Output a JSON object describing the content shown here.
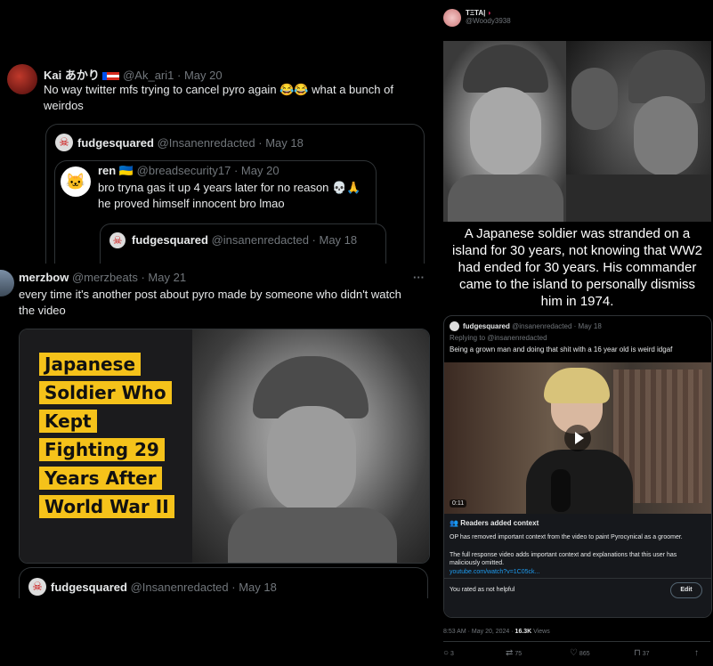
{
  "tweet_kai": {
    "name": "Kai あかり",
    "handle": "@Ak_ari1",
    "date": "· May 20",
    "text_line1": "No way twitter mfs trying to cancel pyro again 😂😂 what a bunch of",
    "text_line2": "weirdos"
  },
  "quote_fudge1": {
    "name": "fudgesquared",
    "handle": "@Insanenredacted",
    "date": "· May 18"
  },
  "quote_ren": {
    "name": "ren 🇺🇦",
    "handle": "@breadsecurity17",
    "date": "· May 20",
    "text_line1": "bro tryna gas it up 4 years later for no reason 💀🙏",
    "text_line2": "he proved himself innocent bro lmao"
  },
  "quote_fudge2": {
    "name": "fudgesquared",
    "handle": "@insanenredacted",
    "date": "· May 18"
  },
  "tweet_merzbow": {
    "name": "merzbow",
    "handle": "@merzbeats",
    "date": "· May 21",
    "more": "···",
    "text_line1": "every time it's another post about pyro made by someone who didn't watch",
    "text_line2": "the video",
    "thumb_lines": [
      "Japanese",
      "Soldier Who",
      "Kept",
      "Fighting 29",
      "Years After",
      "World War II"
    ]
  },
  "quote_fudge3": {
    "name": "fudgesquared",
    "handle": "@Insanenredacted",
    "date": "· May 18"
  },
  "right_post": {
    "name": "ΤΞΤΑ|",
    "handle": "@Woody3938",
    "caption": "A Japanese soldier was stranded on a island for 30 years, not knowing that WW2 had ended for 30 years. His commander came to the island to personally dismiss him in 1974."
  },
  "right_quote": {
    "name": "fudgesquared",
    "handle": "@insanenredacted",
    "date": "· May 18",
    "replying": "Replying to @insanenredacted",
    "text": "Being a grown man and doing that shit with a 16 year old is weird idgaf",
    "video_time": "0:11"
  },
  "community_note": {
    "title": "Readers added context",
    "para1": "OP has removed important context from the video to paint Pyrocynical as a groomer.",
    "para2": "The full response video adds important context and explanations that this user has maliciously omitted.",
    "link": "youtube.com/watch?v=1C05ck...",
    "rated": "You rated as not helpful",
    "edit": "Edit"
  },
  "meta": {
    "time": "8:53 AM · May 20, 2024 · ",
    "views_count": "16.3K",
    "views_label": " Views"
  },
  "actions": {
    "replies": "3",
    "retweets": "75",
    "likes": "865",
    "bookmarks": "37"
  },
  "colors": {
    "background": "#000000",
    "muted": "#71767b",
    "link": "#1d9bf0",
    "thumb_yellow": "#f5c21a",
    "note_bg": "#16181c"
  }
}
